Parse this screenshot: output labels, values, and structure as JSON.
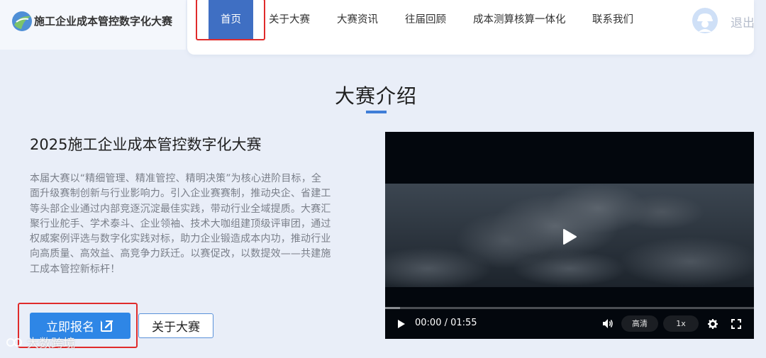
{
  "header": {
    "brand": "施工企业成本管控数字化大赛",
    "nav": [
      {
        "label": "首页",
        "active": true
      },
      {
        "label": "关于大赛",
        "active": false
      },
      {
        "label": "大赛资讯",
        "active": false
      },
      {
        "label": "往届回顾",
        "active": false
      },
      {
        "label": "成本测算核算一体化",
        "active": false
      },
      {
        "label": "联系我们",
        "active": false
      }
    ],
    "logout_label": "退出"
  },
  "section": {
    "title": "大赛介绍"
  },
  "intro": {
    "heading": "2025施工企业成本管控数字化大赛",
    "description_lines": [
      "本届大赛以“精细管理、精准管控、精明决策”为核心进阶目标，全",
      "面升级赛制创新与行业影响力。引入企业赛赛制，推动央企、省建工",
      "等头部企业通过内部竞逐沉淀最佳实践，带动行业全域提质。大赛汇",
      "聚行业舵手、学术泰斗、企业领袖、技术大咖组建顶级评审团，通过",
      "权威案例评选与数字化实践对标，助力企业锻造成本内功，推动行业",
      "向高质量、高效益、高竞争力跃迁。以赛促改，以数提效——共建施",
      "工成本管控新标杆！"
    ],
    "register_label": "立即报名",
    "about_label": "关于大赛"
  },
  "video": {
    "time_display": "00:00 / 01:55",
    "quality_label": "高清",
    "speed_label": "1x",
    "progress": 0.04
  },
  "watermark": {
    "text": "大数跨境"
  },
  "colors": {
    "accent": "#3f6fc3",
    "button": "#2e86e6",
    "highlight_box": "#e02b2b"
  }
}
